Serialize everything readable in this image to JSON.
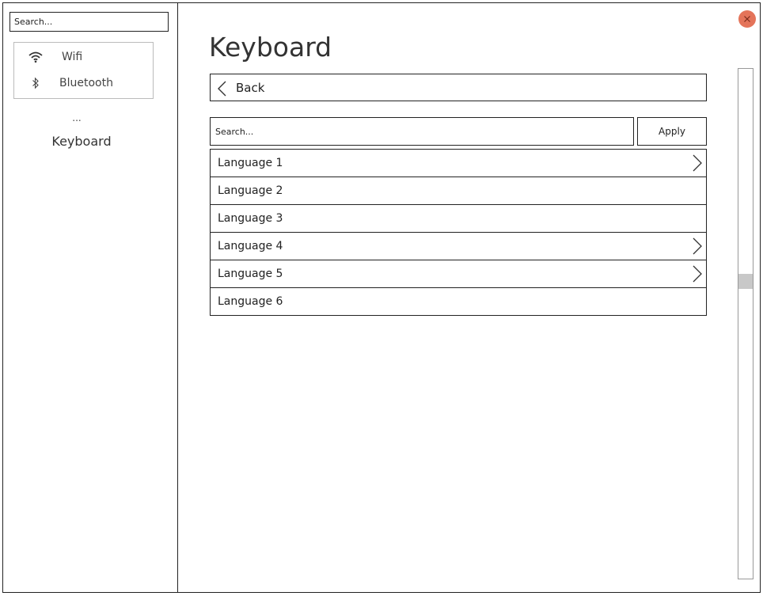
{
  "sidebar": {
    "search_placeholder": "Search...",
    "items": [
      {
        "label": "Wifi",
        "icon": "wifi-icon"
      },
      {
        "label": "Bluetooth",
        "icon": "bluetooth-icon"
      }
    ],
    "ellipsis": "...",
    "current": "Keyboard"
  },
  "main": {
    "title": "Keyboard",
    "back_label": "Back",
    "search_placeholder": "Search...",
    "apply_label": "Apply",
    "languages": [
      {
        "label": "Language 1",
        "has_children": true
      },
      {
        "label": "Language 2",
        "has_children": false
      },
      {
        "label": "Language 3",
        "has_children": false
      },
      {
        "label": "Language 4",
        "has_children": true
      },
      {
        "label": "Language 5",
        "has_children": true
      },
      {
        "label": "Language 6",
        "has_children": false
      }
    ]
  },
  "colors": {
    "close_button": "#e4745a",
    "border": "#222222",
    "scroll_thumb": "#c8c8c8"
  }
}
